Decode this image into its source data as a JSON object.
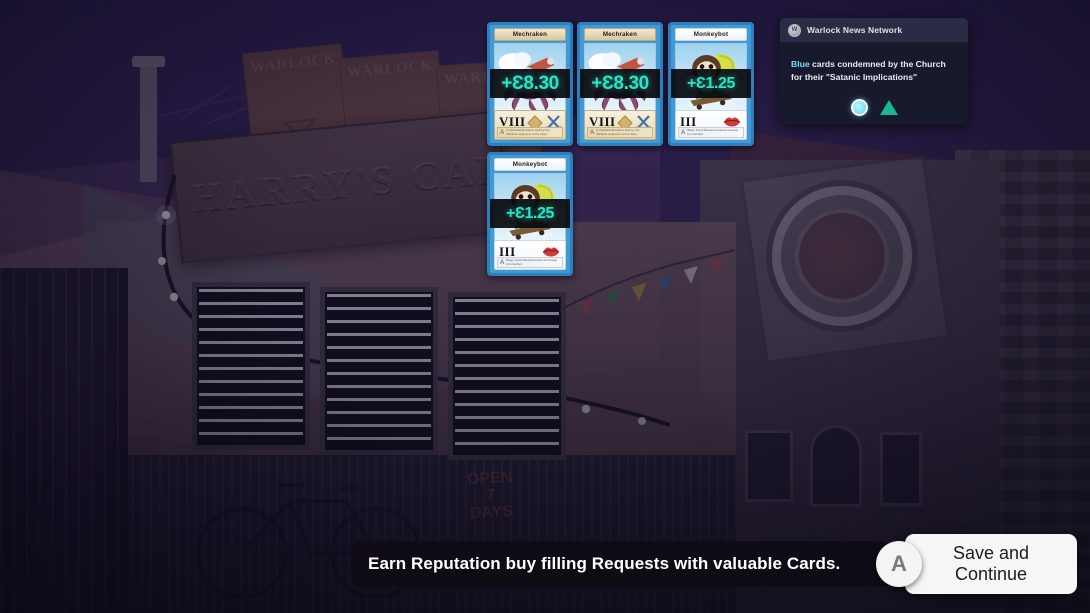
{
  "scene": {
    "shop_sign": "HARRY'S CARD",
    "poster_word": "WARLOCK",
    "open_sign": "OPEN 7 DAYS"
  },
  "cards": [
    {
      "name": "Mechraken",
      "price": "+Ɛ8.30",
      "rank": "VIII",
      "style": "tan",
      "icons": [
        "diamond-icon",
        "crossed-swords-icon"
      ],
      "flavor": "A mechanical kraken built by the Warlock engineers of the deep.",
      "flavor_badge": "A"
    },
    {
      "name": "Mechraken",
      "price": "+Ɛ8.30",
      "rank": "VIII",
      "style": "tan",
      "icons": [
        "diamond-icon",
        "crossed-swords-icon"
      ],
      "flavor": "A mechanical kraken built by the Warlock engineers of the deep.",
      "flavor_badge": "A"
    },
    {
      "name": "Monkeybot",
      "price": "+Ɛ1.25",
      "rank": "III",
      "style": "white",
      "icons": [
        "lips-icon"
      ],
      "flavor": "Beep, boop! Banana fueled and ready for mischief.",
      "flavor_badge": "A"
    },
    {
      "name": "Monkeybot",
      "price": "+Ɛ1.25",
      "rank": "III",
      "style": "white",
      "icons": [
        "lips-icon"
      ],
      "flavor": "Beep, boop! Banana fueled and ready for mischief.",
      "flavor_badge": "A"
    }
  ],
  "news": {
    "channel": "Warlock News Network",
    "headline_highlight": "Blue",
    "headline_rest": " cards condemned by the Church for their \"Satanic Implications\"",
    "logo_label": "W"
  },
  "bottom": {
    "hint": "Earn Reputation buy filling Requests with valuable Cards.",
    "button_key": "A",
    "button_label_line1": "Save and",
    "button_label_line2": "Continue"
  },
  "colors": {
    "price_teal": "#27e6c8",
    "card_border_blue": "#2e7fba",
    "news_bg": "#171a2c",
    "triangle_teal": "#18b892"
  }
}
